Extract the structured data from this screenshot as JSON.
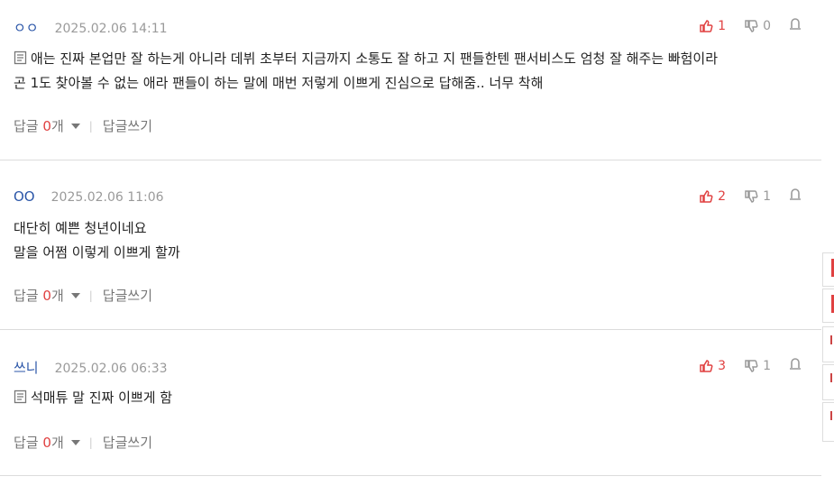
{
  "colors": {
    "accent_red": "#e04141",
    "author_blue": "#2b56a8",
    "muted": "#9a9a9a"
  },
  "comments": [
    {
      "author": "ㅇㅇ",
      "date": "2025.02.06 14:11",
      "up": "1",
      "down": "0",
      "has_memo_icon": true,
      "lines": [
        "애는 진짜 본업만 잘 하는게 아니라 데뷔 초부터 지금까지 소통도 잘 하고 지 팬들한텐 팬서비스도 엄청 잘 해주는 빠험이라",
        "곤 1도 찾아볼 수 없는 애라 팬들이 하는 말에 매번 저렇게 이쁘게 진심으로 답해줌.. 너무 착해"
      ],
      "reply_label": "답글",
      "reply_count": "0",
      "reply_unit": "개",
      "write_label": "답글쓰기"
    },
    {
      "author": "OO",
      "date": "2025.02.06 11:06",
      "up": "2",
      "down": "1",
      "has_memo_icon": false,
      "lines": [
        "대단히 예쁜 청년이네요",
        "말을 어쩜 이렇게 이쁘게 할까"
      ],
      "reply_label": "답글",
      "reply_count": "0",
      "reply_unit": "개",
      "write_label": "답글쓰기"
    },
    {
      "author": "쓰니",
      "date": "2025.02.06 06:33",
      "up": "3",
      "down": "1",
      "has_memo_icon": true,
      "lines": [
        "석매튜 말 진짜 이쁘게 함"
      ],
      "reply_label": "답글",
      "reply_count": "0",
      "reply_unit": "개",
      "write_label": "답글쓰기"
    }
  ],
  "icons": {
    "up": "thumbs-up-icon",
    "down": "thumbs-down-icon",
    "report": "report-icon",
    "memo": "memo-icon",
    "dropdown": "caret-down-icon"
  }
}
